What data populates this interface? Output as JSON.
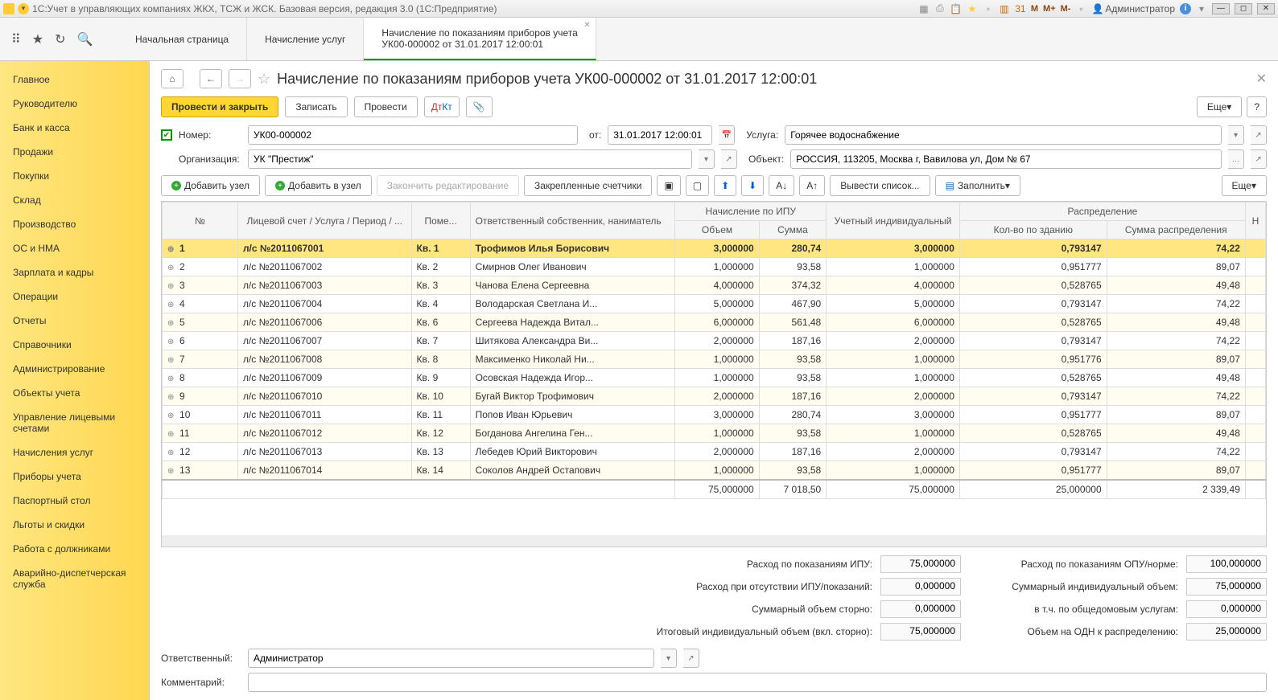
{
  "app": {
    "title": "1С:Учет в управляющих компаниях ЖКХ, ТСЖ и ЖСК. Базовая версия, редакция 3.0  (1С:Предприятие)",
    "user": "Администратор"
  },
  "tabs": [
    {
      "label": "Начальная страница"
    },
    {
      "label": "Начисление услуг"
    },
    {
      "label": "Начисление по показаниям приборов учета",
      "sub": "УК00-000002 от 31.01.2017 12:00:01",
      "active": true
    }
  ],
  "sidebar": [
    "Главное",
    "Руководителю",
    "Банк и касса",
    "Продажи",
    "Покупки",
    "Склад",
    "Производство",
    "ОС и НМА",
    "Зарплата и кадры",
    "Операции",
    "Отчеты",
    "Справочники",
    "Администрирование",
    "Объекты учета",
    "Управление лицевыми счетами",
    "Начисления услуг",
    "Приборы учета",
    "Паспортный стол",
    "Льготы и скидки",
    "Работа с должниками",
    "Аварийно-диспетчерская служба"
  ],
  "page": {
    "title": "Начисление по показаниям приборов учета УК00-000002 от 31.01.2017 12:00:01",
    "btn_post_close": "Провести и закрыть",
    "btn_save": "Записать",
    "btn_post": "Провести",
    "btn_more": "Еще",
    "lbl_number": "Номер:",
    "number": "УК00-000002",
    "lbl_from": "от:",
    "date": "31.01.2017 12:00:01",
    "lbl_service": "Услуга:",
    "service": "Горячее водоснабжение",
    "lbl_org": "Организация:",
    "org": "УК \"Престиж\"",
    "lbl_object": "Объект:",
    "object": "РОССИЯ, 113205, Москва г, Вавилова ул, Дом № 67",
    "btn_add_node": "Добавить узел",
    "btn_add_into": "Добавить в узел",
    "btn_end_edit": "Закончить редактирование",
    "btn_pinned": "Закрепленные счетчики",
    "btn_list": "Вывести список...",
    "btn_fill": "Заполнить"
  },
  "columns": {
    "no": "№",
    "acc": "Лицевой счет / Услуга / Период / ...",
    "room": "Поме...",
    "owner": "Ответственный собственник, наниматель",
    "ipu": "Начисление по ИПУ",
    "vol": "Объем",
    "sum": "Сумма",
    "uind": "Учетный индивидуальный",
    "dist": "Распределение",
    "qty": "Кол-во по зданию",
    "dsum": "Сумма распределения",
    "n": "Н"
  },
  "rows": [
    {
      "n": "1",
      "acc": "л/с №2011067001",
      "room": "Кв. 1",
      "owner": "Трофимов Илья Борисович",
      "vol": "3,000000",
      "sum": "280,74",
      "uind": "3,000000",
      "qty": "0,793147",
      "dsum": "74,22",
      "sel": true
    },
    {
      "n": "2",
      "acc": "л/с №2011067002",
      "room": "Кв. 2",
      "owner": "Смирнов Олег Иванович",
      "vol": "1,000000",
      "sum": "93,58",
      "uind": "1,000000",
      "qty": "0,951777",
      "dsum": "89,07"
    },
    {
      "n": "3",
      "acc": "л/с №2011067003",
      "room": "Кв. 3",
      "owner": "Чанова Елена Сергеевна",
      "vol": "4,000000",
      "sum": "374,32",
      "uind": "4,000000",
      "qty": "0,528765",
      "dsum": "49,48"
    },
    {
      "n": "4",
      "acc": "л/с №2011067004",
      "room": "Кв. 4",
      "owner": "Володарская Светлана И...",
      "vol": "5,000000",
      "sum": "467,90",
      "uind": "5,000000",
      "qty": "0,793147",
      "dsum": "74,22"
    },
    {
      "n": "5",
      "acc": "л/с №2011067006",
      "room": "Кв. 6",
      "owner": "Сергеева Надежда Витал...",
      "vol": "6,000000",
      "sum": "561,48",
      "uind": "6,000000",
      "qty": "0,528765",
      "dsum": "49,48"
    },
    {
      "n": "6",
      "acc": "л/с №2011067007",
      "room": "Кв. 7",
      "owner": "Шитякова Александра Ви...",
      "vol": "2,000000",
      "sum": "187,16",
      "uind": "2,000000",
      "qty": "0,793147",
      "dsum": "74,22"
    },
    {
      "n": "7",
      "acc": "л/с №2011067008",
      "room": "Кв. 8",
      "owner": "Максименко Николай Ни...",
      "vol": "1,000000",
      "sum": "93,58",
      "uind": "1,000000",
      "qty": "0,951776",
      "dsum": "89,07"
    },
    {
      "n": "8",
      "acc": "л/с №2011067009",
      "room": "Кв. 9",
      "owner": "Осовская Надежда Игор...",
      "vol": "1,000000",
      "sum": "93,58",
      "uind": "1,000000",
      "qty": "0,528765",
      "dsum": "49,48"
    },
    {
      "n": "9",
      "acc": "л/с №2011067010",
      "room": "Кв. 10",
      "owner": "Бугай Виктор Трофимович",
      "vol": "2,000000",
      "sum": "187,16",
      "uind": "2,000000",
      "qty": "0,793147",
      "dsum": "74,22"
    },
    {
      "n": "10",
      "acc": "л/с №2011067011",
      "room": "Кв. 11",
      "owner": "Попов Иван Юрьевич",
      "vol": "3,000000",
      "sum": "280,74",
      "uind": "3,000000",
      "qty": "0,951777",
      "dsum": "89,07"
    },
    {
      "n": "11",
      "acc": "л/с №2011067012",
      "room": "Кв. 12",
      "owner": "Богданова Ангелина Ген...",
      "vol": "1,000000",
      "sum": "93,58",
      "uind": "1,000000",
      "qty": "0,528765",
      "dsum": "49,48"
    },
    {
      "n": "12",
      "acc": "л/с №2011067013",
      "room": "Кв. 13",
      "owner": "Лебедев Юрий Викторович",
      "vol": "2,000000",
      "sum": "187,16",
      "uind": "2,000000",
      "qty": "0,793147",
      "dsum": "74,22"
    },
    {
      "n": "13",
      "acc": "л/с №2011067014",
      "room": "Кв. 14",
      "owner": "Соколов Андрей Остапович",
      "vol": "1,000000",
      "sum": "93,58",
      "uind": "1,000000",
      "qty": "0,951777",
      "dsum": "89,07"
    }
  ],
  "totals_row": {
    "vol": "75,000000",
    "sum": "7 018,50",
    "uind": "75,000000",
    "qty": "25,000000",
    "dsum": "2 339,49"
  },
  "summary": {
    "l1": "Расход по показаниям ИПУ:",
    "v1": "75,000000",
    "r1": "Расход по показаниям ОПУ/норме:",
    "rv1": "100,000000",
    "l2": "Расход при отсутствии ИПУ/показаний:",
    "v2": "0,000000",
    "r2": "Суммарный индивидуальный объем:",
    "rv2": "75,000000",
    "l3": "Суммарный объем сторно:",
    "v3": "0,000000",
    "r3": "в т.ч. по общедомовым услугам:",
    "rv3": "0,000000",
    "l4": "Итоговый индивидуальный объем (вкл. сторно):",
    "v4": "75,000000",
    "r4": "Объем на ОДН к распределению:",
    "rv4": "25,000000"
  },
  "bottom": {
    "lbl_resp": "Ответственный:",
    "resp": "Администратор",
    "lbl_comment": "Комментарий:",
    "comment": ""
  }
}
